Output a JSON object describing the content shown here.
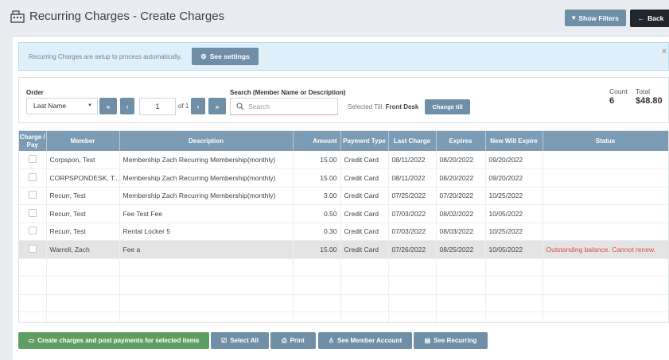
{
  "header": {
    "title": "Recurring Charges - Create Charges",
    "show_filters": "Show Filters",
    "back": "Back"
  },
  "notice": {
    "text": "Recurring Charges are setup to process automatically.",
    "see_settings": "See settings",
    "close": "×"
  },
  "filters": {
    "order_label": "Order",
    "order_value": "Last Name",
    "page_value": "1",
    "page_of": "of 1",
    "search_label": "Search (Member Name or Description)",
    "search_placeholder": "Search",
    "till_label": "Selected Till:",
    "till_value": "Front Desk",
    "change_till": "Change till",
    "count_label": "Count",
    "count_value": "6",
    "total_label": "Total",
    "total_value": "$48.80"
  },
  "table": {
    "columns": [
      "Charge / Pay",
      "Member",
      "Description",
      "Amount",
      "Payment Type",
      "Last Charge",
      "Expires",
      "New Will Expire",
      "Status"
    ],
    "rows": [
      {
        "member": "Corpspon, Test",
        "description": "Membership Zach Recurring Membership(monthly)",
        "amount": "15.00",
        "payment_type": "Credit Card",
        "last_charge": "08/11/2022",
        "expires": "08/20/2022",
        "new_expire": "09/20/2022",
        "status": ""
      },
      {
        "member": "CORPSPONDESK, T...",
        "description": "Membership Zach Recurring Membership(monthly)",
        "amount": "15.00",
        "payment_type": "Credit Card",
        "last_charge": "08/11/2022",
        "expires": "08/20/2022",
        "new_expire": "09/20/2022",
        "status": ""
      },
      {
        "member": "Recurr, Test",
        "description": "Membership Zach Recurring Membership(monthly)",
        "amount": "3.00",
        "payment_type": "Credit Card",
        "last_charge": "07/25/2022",
        "expires": "07/20/2022",
        "new_expire": "10/25/2022",
        "status": ""
      },
      {
        "member": "Recurr, Test",
        "description": "Fee Test Fee",
        "amount": "0.50",
        "payment_type": "Credit Card",
        "last_charge": "07/03/2022",
        "expires": "08/02/2022",
        "new_expire": "10/05/2022",
        "status": ""
      },
      {
        "member": "Recurr, Test",
        "description": "Rental Locker 5",
        "amount": "0.30",
        "payment_type": "Credit Card",
        "last_charge": "07/03/2022",
        "expires": "08/03/2022",
        "new_expire": "10/25/2022",
        "status": ""
      },
      {
        "member": "Warrell, Zach",
        "description": "Fee a",
        "amount": "15.00",
        "payment_type": "Credit Card",
        "last_charge": "07/26/2022",
        "expires": "08/25/2022",
        "new_expire": "10/05/2022",
        "status": "Outstanding balance. Cannot renew."
      }
    ]
  },
  "footer": {
    "create_charges": "Create charges and post payments for selected items",
    "select_all": "Select All",
    "print": "Print",
    "see_member_account": "See Member Account",
    "see_recurring": "See Recurring"
  },
  "colors": {
    "header_bg": "#7c9cb5",
    "button_slate": "#6f8fa6",
    "button_green": "#5f9e62",
    "status_error": "#e04b4b"
  }
}
